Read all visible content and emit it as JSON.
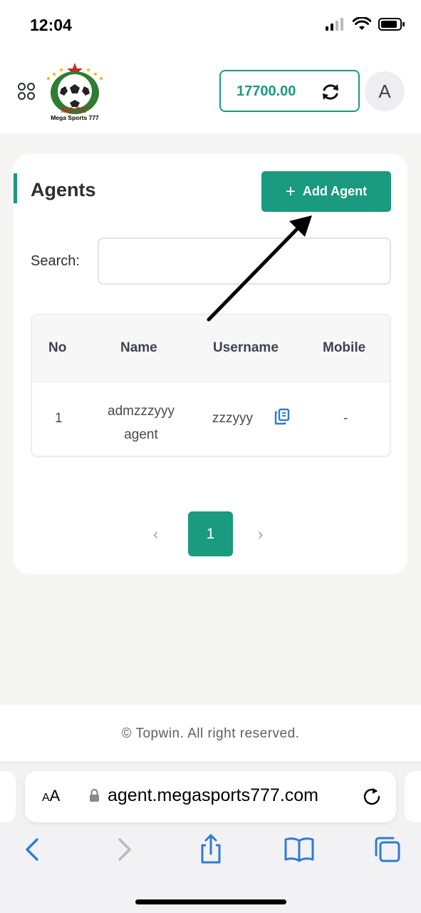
{
  "status_bar": {
    "time": "12:04"
  },
  "header": {
    "logo_text": "MS 777",
    "logo_subtext": "Mega Sports 777",
    "balance": "17700.00",
    "avatar_initial": "A"
  },
  "page": {
    "title": "Agents",
    "add_button_label": "Add Agent",
    "search_label": "Search:",
    "search_value": ""
  },
  "table": {
    "columns": [
      "No",
      "Name",
      "Username",
      "Mobile"
    ],
    "rows": [
      {
        "no": "1",
        "name_line1": "admzzzyyy",
        "name_line2": "agent",
        "username": "zzzyyy",
        "mobile": "-"
      }
    ]
  },
  "pagination": {
    "prev": "‹",
    "current": "1",
    "next": "›"
  },
  "footer": {
    "text": "© Topwin. All right reserved."
  },
  "browser": {
    "aa_label_small": "A",
    "aa_label_large": "A",
    "url": "agent.megasports777.com"
  },
  "colors": {
    "accent": "#1a9a7e",
    "link_blue": "#2f7bd6"
  },
  "icons": [
    "grid-icon",
    "refresh-icon",
    "plus-icon",
    "copy-icon",
    "lock-icon",
    "reload-icon",
    "back-icon",
    "forward-icon",
    "share-icon",
    "bookmarks-icon",
    "tabs-icon"
  ]
}
